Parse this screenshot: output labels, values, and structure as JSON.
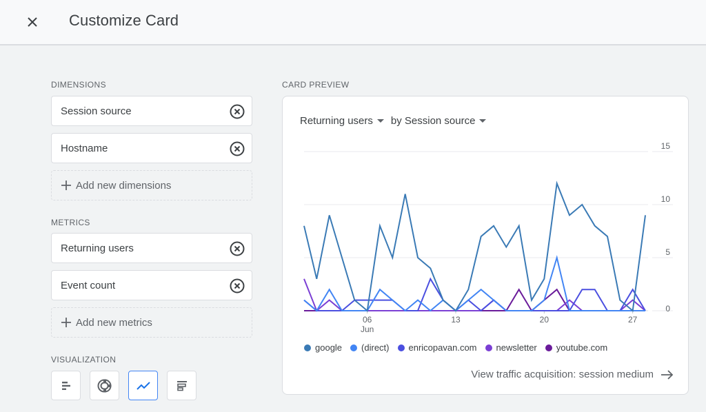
{
  "header": {
    "title": "Customize Card",
    "close_icon": "close-icon"
  },
  "dimensions": {
    "label": "DIMENSIONS",
    "items": [
      {
        "label": "Session source"
      },
      {
        "label": "Hostname"
      }
    ],
    "add_label": "Add new dimensions"
  },
  "metrics": {
    "label": "METRICS",
    "items": [
      {
        "label": "Returning users"
      },
      {
        "label": "Event count"
      }
    ],
    "add_label": "Add new metrics"
  },
  "visualization": {
    "label": "VISUALIZATION",
    "options": [
      {
        "icon": "bar-chart-icon",
        "selected": false
      },
      {
        "icon": "donut-chart-icon",
        "selected": false
      },
      {
        "icon": "line-chart-icon",
        "selected": true
      },
      {
        "icon": "table-chart-icon",
        "selected": false
      }
    ]
  },
  "preview": {
    "label": "CARD PREVIEW",
    "metric_dropdown": "Returning users",
    "dimension_dropdown": "by Session source",
    "footer_link": "View traffic acquisition: session medium"
  },
  "chart_data": {
    "type": "line",
    "title": "Returning users by Session source",
    "x": [
      "01",
      "02",
      "03",
      "04",
      "05",
      "06",
      "07",
      "08",
      "09",
      "10",
      "11",
      "12",
      "13",
      "14",
      "15",
      "16",
      "17",
      "18",
      "19",
      "20",
      "21",
      "22",
      "23",
      "24",
      "25",
      "26",
      "27",
      "28"
    ],
    "x_month": "Jun",
    "xtick_labels": [
      {
        "index": 5,
        "label": "06",
        "sub": "Jun"
      },
      {
        "index": 12,
        "label": "13"
      },
      {
        "index": 19,
        "label": "20"
      },
      {
        "index": 26,
        "label": "27"
      }
    ],
    "yticks": [
      0,
      5,
      10,
      15
    ],
    "ylim": [
      0,
      15
    ],
    "y_axis_position": "right",
    "grid": true,
    "legend_position": "bottom",
    "series": [
      {
        "name": "google",
        "color": "#3a7ab5",
        "values": [
          8,
          3,
          9,
          5,
          1,
          0,
          8,
          5,
          11,
          5,
          4,
          1,
          0,
          2,
          7,
          8,
          6,
          8,
          1,
          3,
          12,
          9,
          10,
          8,
          7,
          1,
          0,
          9
        ]
      },
      {
        "name": "(direct)",
        "color": "#4285f4",
        "values": [
          1,
          0,
          2,
          0,
          0,
          0,
          2,
          1,
          0,
          1,
          0,
          1,
          0,
          1,
          2,
          1,
          0,
          0,
          0,
          1,
          5,
          0,
          0,
          0,
          0,
          0,
          0,
          0
        ]
      },
      {
        "name": "enricopavan.com",
        "color": "#4b4fe0",
        "values": [
          1,
          0,
          0,
          0,
          1,
          1,
          1,
          1,
          0,
          0,
          3,
          1,
          0,
          1,
          0,
          1,
          0,
          0,
          0,
          0,
          0,
          0,
          2,
          2,
          0,
          0,
          2,
          0
        ]
      },
      {
        "name": "newsletter",
        "color": "#7b3fd4",
        "values": [
          3,
          0,
          1,
          0,
          0,
          0,
          0,
          0,
          0,
          0,
          0,
          0,
          0,
          0,
          0,
          1,
          0,
          0,
          0,
          0,
          0,
          1,
          0,
          0,
          0,
          0,
          1,
          0
        ]
      },
      {
        "name": "youtube.com",
        "color": "#6a1b9a",
        "values": [
          0,
          0,
          0,
          0,
          0,
          0,
          0,
          0,
          0,
          0,
          0,
          0,
          0,
          0,
          0,
          0,
          0,
          2,
          0,
          1,
          2,
          0,
          0,
          0,
          0,
          0,
          0,
          0
        ]
      }
    ]
  }
}
